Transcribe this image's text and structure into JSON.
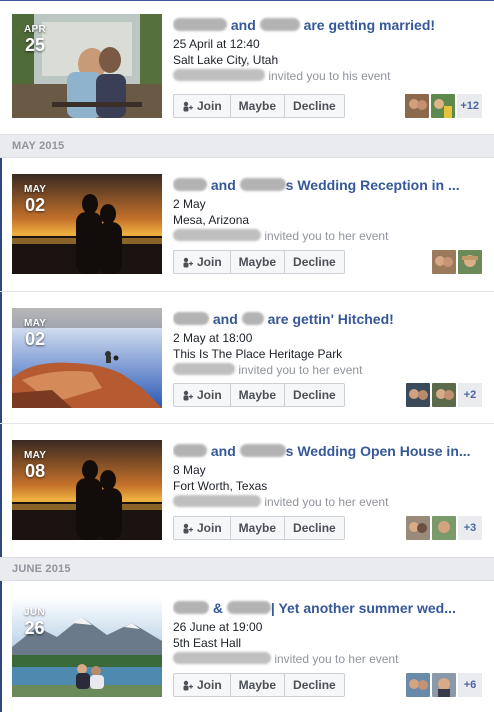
{
  "month_headers": [
    "MAY 2015",
    "JUNE 2015"
  ],
  "events": [
    {
      "month": "APR",
      "day": "25",
      "title_mid": "and",
      "title_end": "are getting married!",
      "datetime": "25 April at 12:40",
      "location": "Salt Lake City, Utah",
      "invite_text": "invited you to his event",
      "more_count": "+12",
      "image": "couple-bench-photo"
    },
    {
      "month": "MAY",
      "day": "02",
      "title_mid": "and",
      "title_end": "s Wedding Reception in ...",
      "datetime": "2 May",
      "location": "Mesa, Arizona",
      "invite_text": "invited you to her event",
      "more_count": "",
      "image": "sunset-silhouette-photo"
    },
    {
      "month": "MAY",
      "day": "02",
      "title_mid": "and",
      "title_end": "are gettin' Hitched!",
      "datetime": "2 May at 18:00",
      "location": "This Is The Place Heritage Park",
      "invite_text": "invited you to her event",
      "more_count": "+2",
      "image": "red-rock-photo"
    },
    {
      "month": "MAY",
      "day": "08",
      "title_mid": "and",
      "title_end": "s Wedding Open House in...",
      "datetime": "8 May",
      "location": "Fort Worth, Texas",
      "invite_text": "invited you to her event",
      "more_count": "+3",
      "image": "sunset-silhouette-photo"
    },
    {
      "month": "JUN",
      "day": "26",
      "title_mid": "&",
      "title_end": "| Yet another summer wed...",
      "datetime": "26 June at 19:00",
      "location": "5th East Hall",
      "invite_text": "invited you to her event",
      "more_count": "+6",
      "image": "mountain-lake-photo"
    }
  ],
  "buttons": {
    "join": "Join",
    "maybe": "Maybe",
    "decline": "Decline"
  },
  "colors": {
    "title": "#365899",
    "accent_bar": "#2f477a",
    "muted": "#90949c"
  }
}
